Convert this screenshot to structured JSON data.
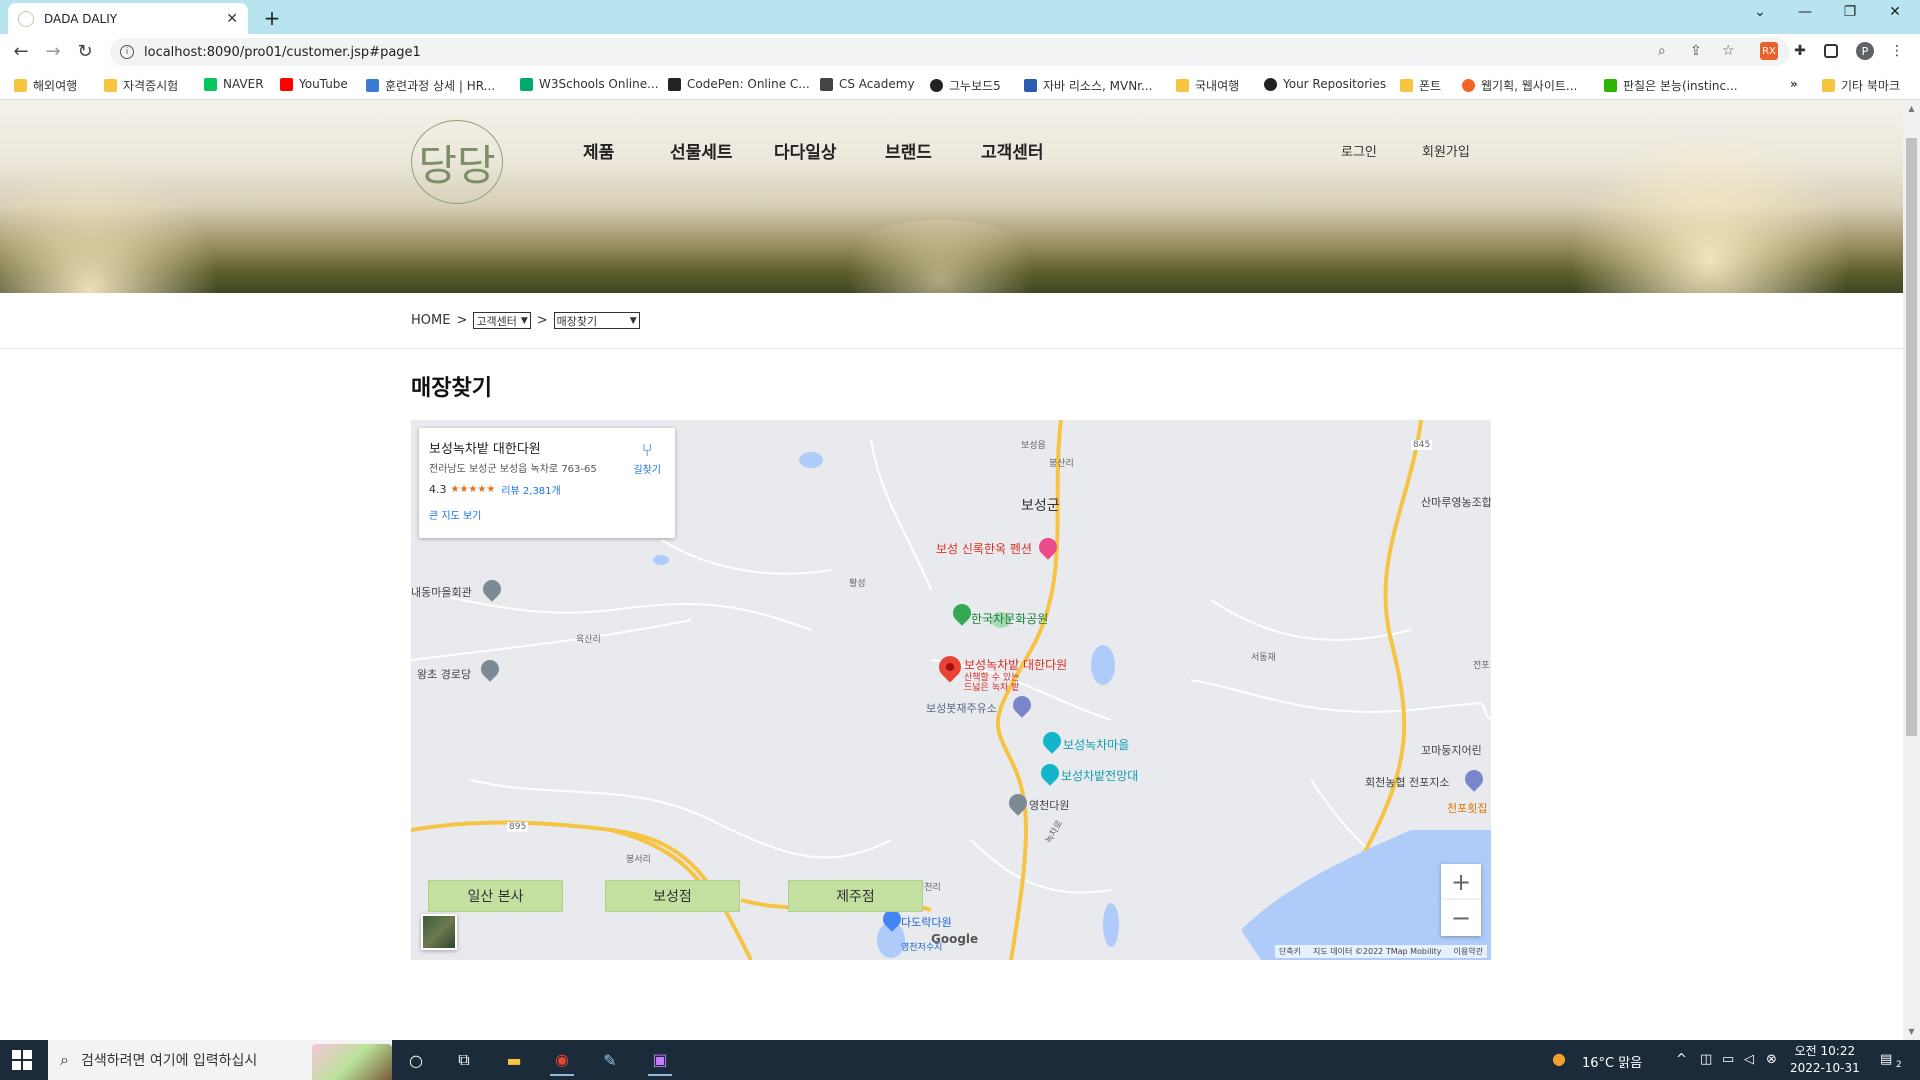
{
  "browser": {
    "tab_title": "DADA DALIY",
    "url": "localhost:8090/pro01/customer.jsp#page1",
    "bookmarks": [
      "해외여행",
      "자격증시험",
      "NAVER",
      "YouTube",
      "훈련과정 상세 | HR...",
      "W3Schools Online...",
      "CodePen: Online C...",
      "CS Academy",
      "그누보드5",
      "자바 리소스, MVNr...",
      "국내여행",
      "Your Repositories",
      "폰트",
      "웹기획, 웹사이트...",
      "판칠은 본능(instinc...",
      "기타 북마크"
    ],
    "overflow_label": "»",
    "profile_initial": "P"
  },
  "header": {
    "logo_text": "당당",
    "nav": [
      "제품",
      "선물세트",
      "다다일상",
      "브랜드",
      "고객센터"
    ],
    "login": "로그인",
    "signup": "회원가입"
  },
  "breadcrumb": {
    "home": "HOME",
    "sep": ">",
    "section": "고객센터",
    "page": "매장찾기"
  },
  "page_title": "매장찾기",
  "map": {
    "card": {
      "name": "보성녹차밭 대한다원",
      "address": "전라남도 보성군 보성읍 녹차로 763-65",
      "rating": "4.3",
      "stars": "★★★★★",
      "reviews": "리뷰 2,381개",
      "big_map": "큰 지도 보기",
      "directions": "길찾기"
    },
    "labels": {
      "boseong_gun": "보성군",
      "boseong_eup": "보성읍",
      "bongsanri": "봉산리",
      "pension": "보성 신록한옥 펜션",
      "hwalseong": "활성",
      "culture_park": "한국차문화공원",
      "naedong": "내동마을회관",
      "yuksanri": "육산리",
      "wangcho": "왕초 경로당",
      "daehan": "보성녹차밭 대한다원",
      "daehan_sub1": "산책할 수 있는",
      "daehan_sub2": "드넓은 녹차 밭",
      "gas": "보성봇재주유소",
      "nokcha_village": "보성녹차마을",
      "observatory": "보성차밭전망대",
      "yeongcheon": "영천다원",
      "dadorak": "다도락다원",
      "reservoir": "영천저수지",
      "yeongcheonri": "영천리",
      "bongseoli": "봉서리",
      "sanmaru": "산마루영농조합법인",
      "seodong": "서동재",
      "kkomadong": "꼬마둥지어린",
      "nonghyup": "회천농협 전포지소",
      "jeonpo": "전포횟집",
      "nokcharo": "녹차로",
      "jeonpo_label": "전포",
      "r845": "845",
      "r895": "895",
      "google": "Google",
      "attr_shortcut": "단축키",
      "attr_data": "지도 데이터 ©2022 TMap Mobility",
      "attr_terms": "이용약관"
    },
    "zoom_in": "+",
    "zoom_out": "−"
  },
  "stores": [
    "일산 본사",
    "보성점",
    "제주점"
  ],
  "taskbar": {
    "search_placeholder": "검색하려면 여기에 입력하십시",
    "weather": "16°C 맑음",
    "time": "오전 10:22",
    "date": "2022-10-31",
    "notifications": "2"
  },
  "colors": {
    "accent_button": "#c3e0a0",
    "taskbar": "#1c2b3a",
    "tabbar": "#b8e4ef"
  }
}
